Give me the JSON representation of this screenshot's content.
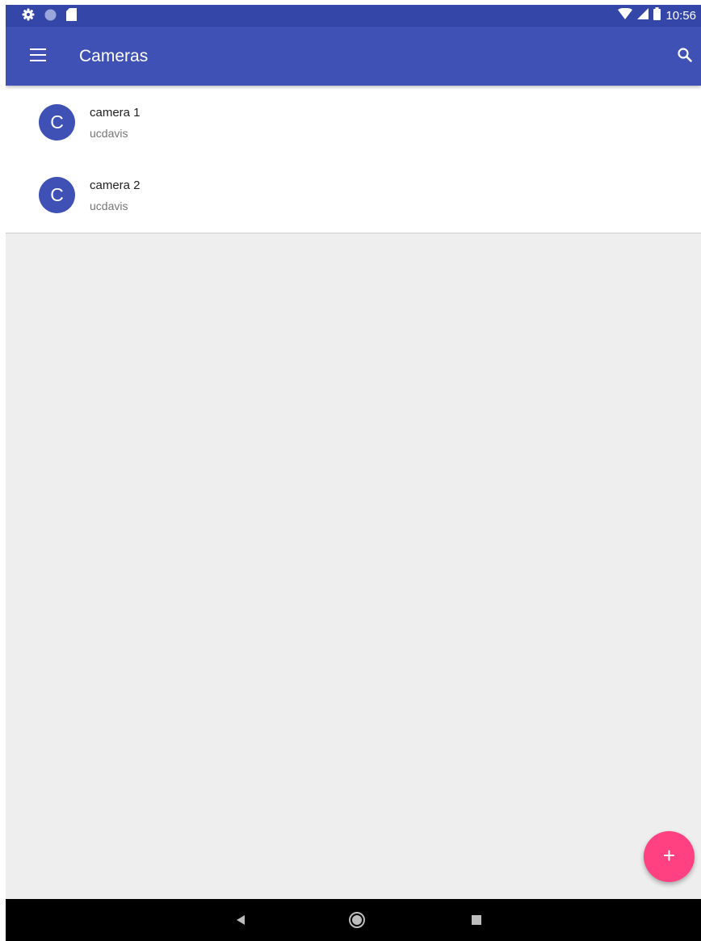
{
  "status_bar": {
    "left_icons": [
      "settings-icon",
      "circle-icon",
      "sd-card-icon"
    ],
    "right_icons": [
      "wifi-icon",
      "signal-icon",
      "battery-icon"
    ],
    "time": "10:56"
  },
  "app_bar": {
    "title": "Cameras",
    "menu_icon": "menu-icon",
    "search_icon": "search-icon"
  },
  "cameras": [
    {
      "avatar_letter": "C",
      "name": "camera 1",
      "subtitle": "ucdavis"
    },
    {
      "avatar_letter": "C",
      "name": "camera 2",
      "subtitle": "ucdavis"
    }
  ],
  "fab": {
    "label": "+",
    "icon": "add-icon"
  },
  "nav_bar": {
    "icons": [
      "back-icon",
      "home-icon",
      "recents-icon"
    ]
  },
  "colors": {
    "status_bar": "#3446a8",
    "primary": "#3f51b5",
    "accent": "#ff4081",
    "background": "#eeeeee"
  }
}
